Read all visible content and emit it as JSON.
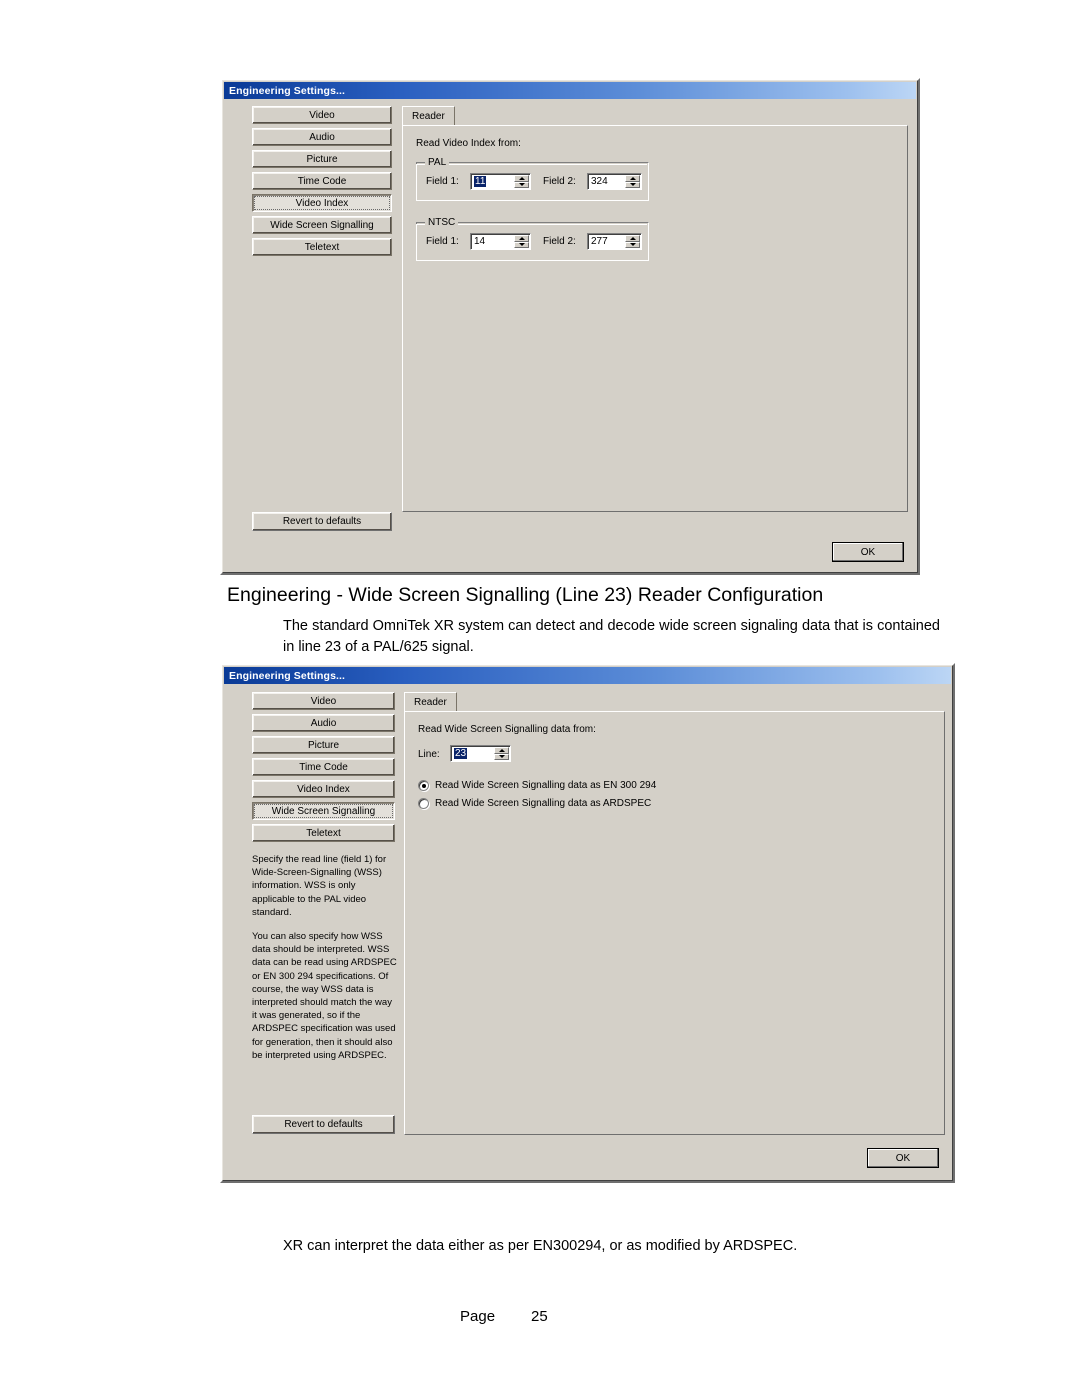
{
  "page": {
    "footer_label": "Page",
    "footer_number": "25"
  },
  "document": {
    "heading": "Engineering - Wide Screen Signalling (Line 23) Reader Configuration",
    "paragraph": "The standard OmniTek XR system can detect and decode wide screen signaling data that is contained in line 23 of a PAL/625 signal.",
    "caption": "XR can interpret the data either as per EN300294, or as modified by ARDSPEC."
  },
  "dialog1": {
    "title": "Engineering Settings...",
    "nav_items": [
      {
        "label": "Video",
        "selected": false
      },
      {
        "label": "Audio",
        "selected": false
      },
      {
        "label": "Picture",
        "selected": false
      },
      {
        "label": "Time Code",
        "selected": false
      },
      {
        "label": "Video Index",
        "selected": true
      },
      {
        "label": "Wide Screen Signalling",
        "selected": false
      },
      {
        "label": "Teletext",
        "selected": false
      }
    ],
    "revert_label": "Revert to defaults",
    "ok_label": "OK",
    "tab_label": "Reader",
    "section_label": "Read Video Index from:",
    "pal": {
      "group_title": "PAL",
      "field1_label": "Field 1:",
      "field1_value": "11",
      "field2_label": "Field 2:",
      "field2_value": "324"
    },
    "ntsc": {
      "group_title": "NTSC",
      "field1_label": "Field 1:",
      "field1_value": "14",
      "field2_label": "Field 2:",
      "field2_value": "277"
    }
  },
  "dialog2": {
    "title": "Engineering Settings...",
    "nav_items": [
      {
        "label": "Video",
        "selected": false
      },
      {
        "label": "Audio",
        "selected": false
      },
      {
        "label": "Picture",
        "selected": false
      },
      {
        "label": "Time Code",
        "selected": false
      },
      {
        "label": "Video Index",
        "selected": false
      },
      {
        "label": "Wide Screen Signalling",
        "selected": true
      },
      {
        "label": "Teletext",
        "selected": false
      }
    ],
    "help_paragraph_1": "Specify the read line (field 1) for Wide-Screen-Signalling (WSS) information. WSS is only applicable to the PAL video standard.",
    "help_paragraph_2": "You can also specify how WSS data should be interpreted. WSS data can be read using ARDSPEC or EN 300 294 specifications. Of course, the way WSS data is interpreted should match the way it was generated, so if the ARDSPEC specification was used for generation, then it should also be interpreted using ARDSPEC.",
    "revert_label": "Revert to defaults",
    "ok_label": "OK",
    "tab_label": "Reader",
    "section_label": "Read Wide Screen Signalling data from:",
    "line_label": "Line:",
    "line_value": "23",
    "radio_en_label": "Read Wide Screen Signalling data as EN 300 294",
    "radio_en_checked": true,
    "radio_ardspec_label": "Read Wide Screen Signalling data as ARDSPEC",
    "radio_ardspec_checked": false
  }
}
